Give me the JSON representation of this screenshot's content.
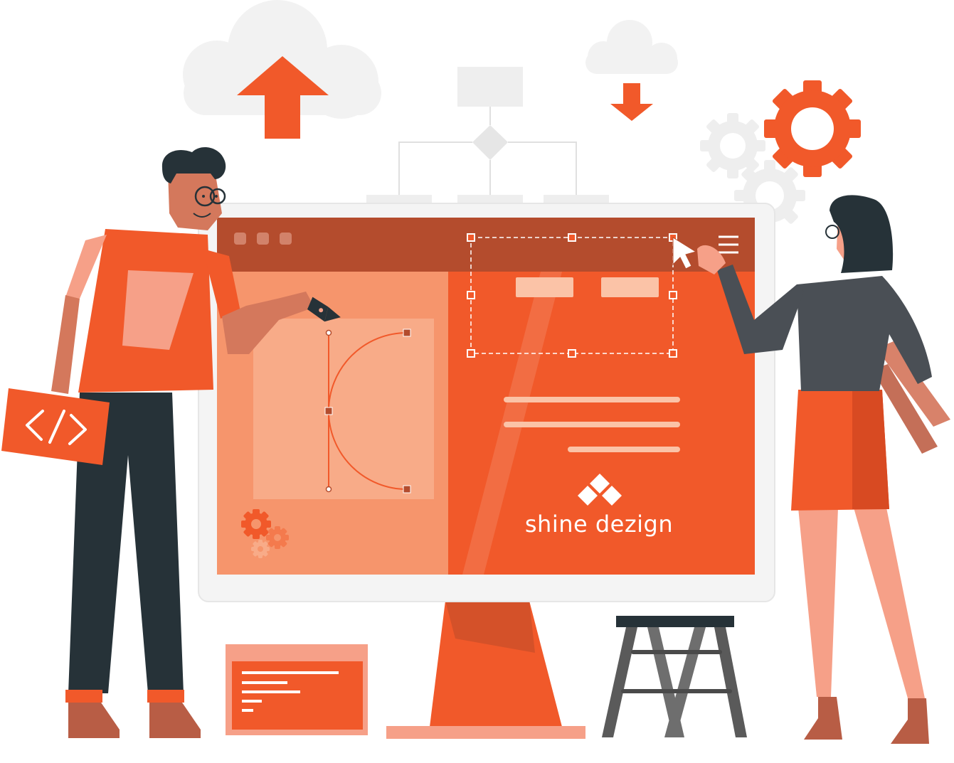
{
  "brand": {
    "name": "shine dezign"
  },
  "browser": {
    "menu_icon": "hamburger-icon"
  },
  "icons": {
    "upload": "upload-arrow-icon",
    "download": "download-arrow-icon",
    "gear": "gear-icon",
    "code": "code-icon",
    "logo": "diamond-logo-icon"
  },
  "colors": {
    "primary": "#f1592a",
    "dark_bar": "#b44c2d",
    "light_panel": "#f6956c",
    "artboard": "#f8ab88",
    "pale_button": "#fbc3a7",
    "cloud": "#f2f2f2",
    "dark": "#263238"
  }
}
